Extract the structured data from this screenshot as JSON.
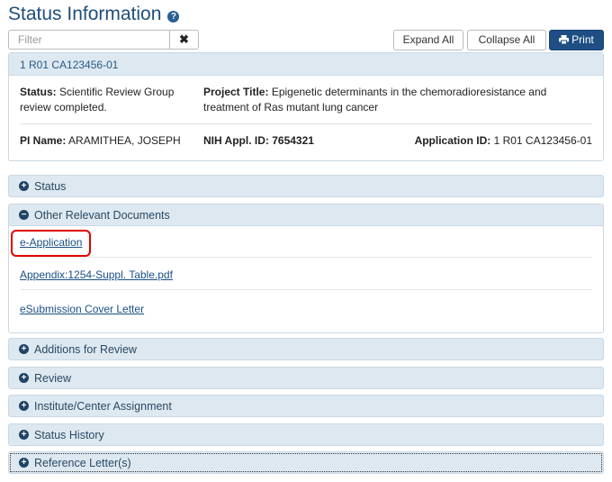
{
  "header": {
    "title": "Status Information",
    "help_icon": "question-circle-icon"
  },
  "toolbar": {
    "filter_placeholder": "Filter",
    "clear_icon": "✖",
    "expand_all": "Expand All",
    "collapse_all": "Collapse All",
    "print": "Print"
  },
  "summary": {
    "grant_number": "1 R01  CA123456-01",
    "status_label": "Status:",
    "status_value": "Scientific Review Group review completed.",
    "project_label": "Project Title:",
    "project_value": "Epigenetic determinants in the chemoradioresistance and treatment of Ras mutant lung cancer",
    "pi_label": "PI Name:",
    "pi_value": "ARAMITHEA, JOSEPH",
    "appl_label": "NIH Appl. ID:",
    "appl_value": "7654321",
    "appid_label": "Application ID:",
    "appid_value": "1 R01  CA123456-01"
  },
  "panels": {
    "status": "Status",
    "other_docs": "Other Relevant Documents",
    "additions": "Additions for Review",
    "review": "Review",
    "institute": "Institute/Center Assignment",
    "history": "Status History",
    "reference": "Reference Letter(s)"
  },
  "documents": [
    "e-Application",
    "Appendix:1254-Suppl. Table.pdf",
    "eSubmission Cover Letter"
  ],
  "colors": {
    "title": "#1f4e79",
    "panel_bg": "#dde8f0",
    "print_button": "#1e4e84",
    "highlight": "#e00000"
  }
}
